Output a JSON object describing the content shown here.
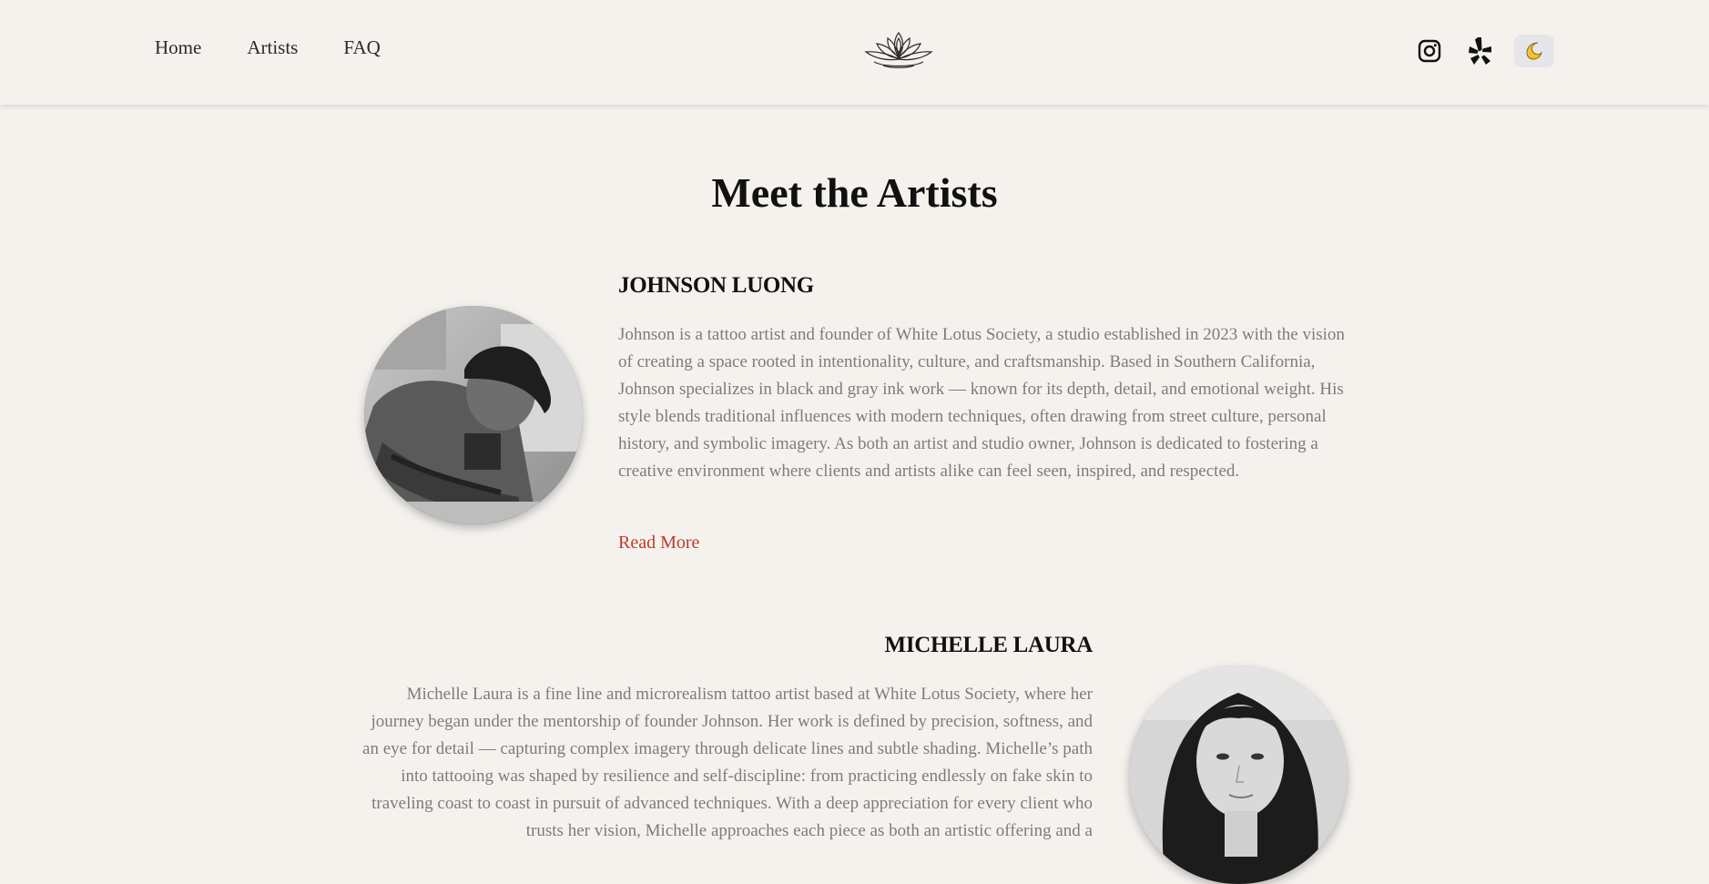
{
  "nav": {
    "items": [
      {
        "label": "Home"
      },
      {
        "label": "Artists"
      },
      {
        "label": "FAQ"
      }
    ]
  },
  "header": {
    "logo_icon": "lotus-icon",
    "social": [
      {
        "icon": "instagram-icon"
      },
      {
        "icon": "yelp-icon"
      }
    ],
    "theme_toggle_icon": "moon-icon"
  },
  "colors": {
    "background": "#f5f2ee",
    "accent": "#c0392b",
    "body_text": "#7c7c7c",
    "toggle_bg": "#e5e5ea",
    "moon": "#f2c230"
  },
  "main": {
    "title": "Meet the Artists",
    "artists": [
      {
        "name": "JOHNSON LUONG",
        "bio": "Johnson is a tattoo artist and founder of White Lotus Society, a studio established in 2023 with the vision of creating a space rooted in intentionality, culture, and craftsmanship. Based in Southern California, Johnson specializes in black and gray ink work — known for its depth, detail, and emotional weight. His style blends traditional influences with modern techniques, often drawing from street culture, personal history, and symbolic imagery. As both an artist and studio owner, Johnson is dedicated to fostering a creative environment where clients and artists alike can feel seen, inspired, and respected.",
        "read_more": "Read More",
        "photo_icon": "artist-photo-johnson"
      },
      {
        "name": "MICHELLE LAURA",
        "bio": "Michelle Laura is a fine line and microrealism tattoo artist based at White Lotus Society, where her journey began under the mentorship of founder Johnson. Her work is defined by precision, softness, and an eye for detail — capturing complex imagery through delicate lines and subtle shading. Michelle’s path into tattooing was shaped by resilience and self-discipline: from practicing endlessly on fake skin to traveling coast to coast in pursuit of advanced techniques. With a deep appreciation for every client who trusts her vision, Michelle approaches each piece as both an artistic offering and a",
        "photo_icon": "artist-photo-michelle"
      }
    ]
  }
}
